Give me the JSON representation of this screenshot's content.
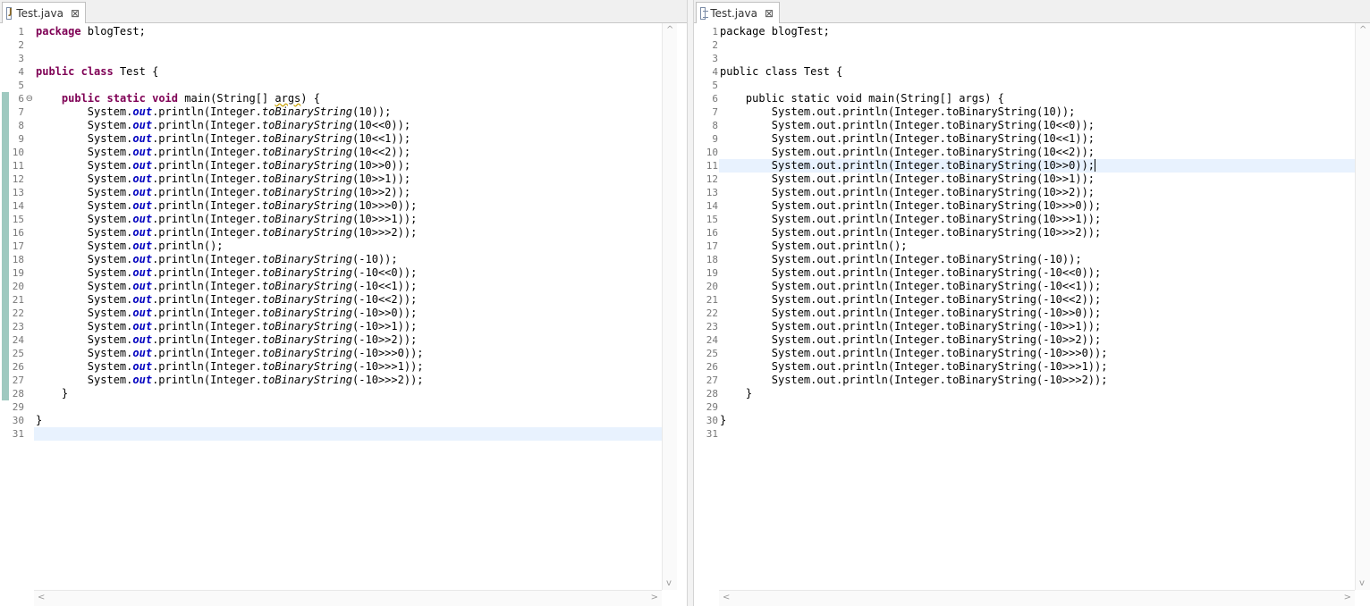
{
  "left_tab": {
    "title": "Test.java",
    "close": "⊠",
    "icon": "java-file-icon"
  },
  "right_tab": {
    "title": "Test.java",
    "close": "⊠",
    "icon": "text-file-icon"
  },
  "code_lines": [
    "package blogTest;",
    "",
    "",
    "public class Test {",
    "",
    "    public static void main(String[] args) {",
    "        System.out.println(Integer.toBinaryString(10));",
    "        System.out.println(Integer.toBinaryString(10<<0));",
    "        System.out.println(Integer.toBinaryString(10<<1));",
    "        System.out.println(Integer.toBinaryString(10<<2));",
    "        System.out.println(Integer.toBinaryString(10>>0));",
    "        System.out.println(Integer.toBinaryString(10>>1));",
    "        System.out.println(Integer.toBinaryString(10>>2));",
    "        System.out.println(Integer.toBinaryString(10>>>0));",
    "        System.out.println(Integer.toBinaryString(10>>>1));",
    "        System.out.println(Integer.toBinaryString(10>>>2));",
    "        System.out.println();",
    "        System.out.println(Integer.toBinaryString(-10));",
    "        System.out.println(Integer.toBinaryString(-10<<0));",
    "        System.out.println(Integer.toBinaryString(-10<<1));",
    "        System.out.println(Integer.toBinaryString(-10<<2));",
    "        System.out.println(Integer.toBinaryString(-10>>0));",
    "        System.out.println(Integer.toBinaryString(-10>>1));",
    "        System.out.println(Integer.toBinaryString(-10>>2));",
    "        System.out.println(Integer.toBinaryString(-10>>>0));",
    "        System.out.println(Integer.toBinaryString(-10>>>1));",
    "        System.out.println(Integer.toBinaryString(-10>>>2));",
    "    }",
    "",
    "}",
    ""
  ],
  "left_editor": {
    "current_line": 31,
    "fold_marker": "⊖",
    "fold_line": 6,
    "changed_from": 6,
    "changed_to": 28
  },
  "right_editor": {
    "current_line": 11,
    "caret_after": "System.out.println(Integer.toBinaryString(10>>0));"
  },
  "scroll_arrows": {
    "up": "^",
    "down": "v",
    "left": "<",
    "right": ">"
  }
}
